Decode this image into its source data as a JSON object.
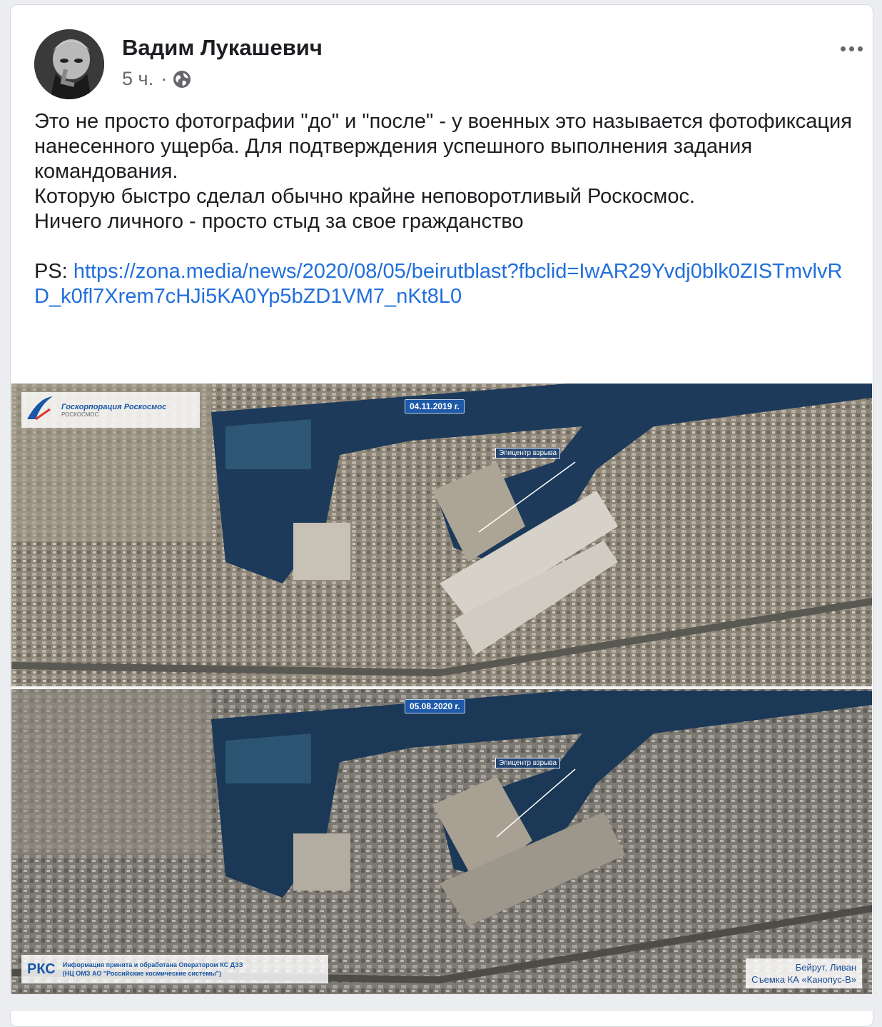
{
  "post": {
    "author": "Вадим Лукашевич",
    "time": "5 ч.",
    "separator": "·",
    "paragraphs": [
      "Это не просто фотографии \"до\" и \"после\" - у военных это называется фотофиксация нанесенного ущерба. Для подтверждения успешного выполнения задания командования.",
      "Которую быстро сделал обычно крайне неповоротливый Роскосмос.",
      "Ничего личного - просто стыд за свое гражданство"
    ],
    "ps_label": "PS:",
    "link": "https://zona.media/news/2020/08/05/beirutblast?fbclid=IwAR29Yvdj0blk0ZISTmvlvRD_k0fl7Xrem7cHJi5KA0Yp5bZD1VM7_nKt8L0"
  },
  "image": {
    "logo_sub": "РОСКОСМОС",
    "logo_name": "Госкорпорация Роскосмос",
    "date_before": "04.11.2019 г.",
    "date_after": "05.08.2020 г.",
    "epicenter_before": "Эпицентр взрыва",
    "epicenter_after": "Эпицентр взрыва",
    "rks": "РКС",
    "operator_line1": "Информация принята и обработана Оператором КС ДЗЗ",
    "operator_line2": "(НЦ ОМЗ АО \"Российские космические системы\")",
    "location": "Бейрут, Ливан",
    "satellite": "Съемка КА «Канопус-В»"
  },
  "icons": {
    "more": "more-horizontal-icon",
    "privacy": "globe-icon"
  }
}
